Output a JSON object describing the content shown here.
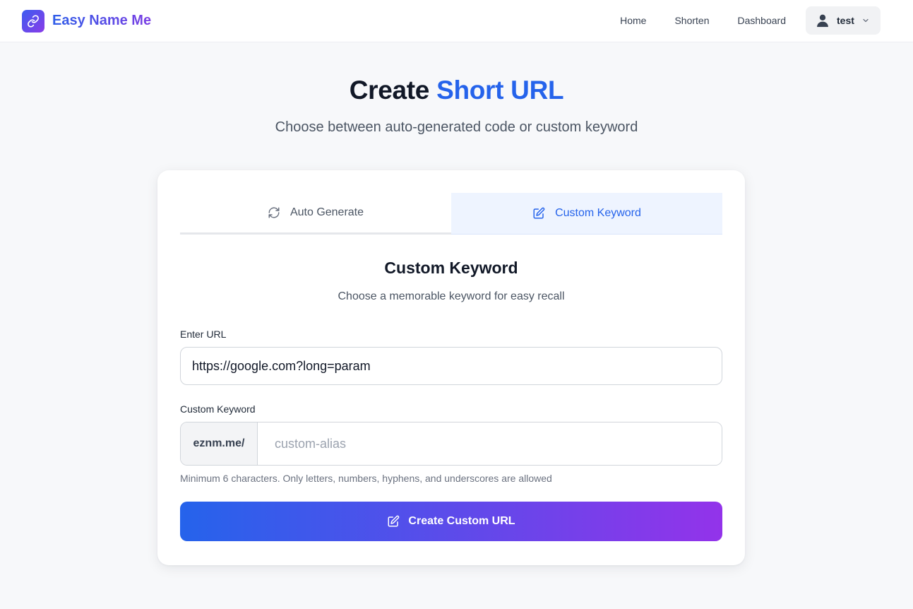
{
  "header": {
    "brand": "Easy Name Me",
    "nav": [
      {
        "label": "Home"
      },
      {
        "label": "Shorten"
      },
      {
        "label": "Dashboard"
      }
    ],
    "user": {
      "name": "test"
    }
  },
  "hero": {
    "title_prefix": "Create ",
    "title_accent": "Short URL",
    "subtitle": "Choose between auto-generated code or custom keyword"
  },
  "tabs": [
    {
      "label": "Auto Generate",
      "icon": "refresh-icon",
      "active": false
    },
    {
      "label": "Custom Keyword",
      "icon": "edit-icon",
      "active": true
    }
  ],
  "form": {
    "title": "Custom Keyword",
    "subtitle": "Choose a memorable keyword for easy recall",
    "url_label": "Enter URL",
    "url_value": "https://google.com?long=param",
    "keyword_label": "Custom Keyword",
    "keyword_prefix": "eznm.me/",
    "keyword_placeholder": "custom-alias",
    "keyword_value": "",
    "hint": "Minimum 6 characters. Only letters, numbers, hyphens, and underscores are allowed",
    "submit_label": "Create Custom URL"
  },
  "colors": {
    "accent": "#2563eb",
    "gradient_start": "#2563eb",
    "gradient_end": "#9333ea"
  }
}
